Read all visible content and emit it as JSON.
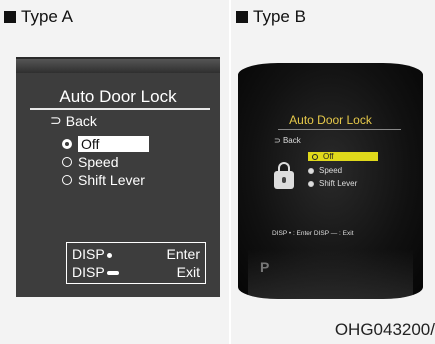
{
  "headers": {
    "type_a": "Type A",
    "type_b": "Type B"
  },
  "figure_code": "OHG043200/",
  "type_a": {
    "title": "Auto Door Lock",
    "back": "Back",
    "options": [
      "Off",
      "Speed",
      "Shift Lever"
    ],
    "selected": "Off",
    "help": {
      "disp": "DISP",
      "enter": "Enter",
      "exit": "Exit"
    }
  },
  "type_b": {
    "title": "Auto Door Lock",
    "back": "Back",
    "options": [
      "Off",
      "Speed",
      "Shift Lever"
    ],
    "selected": "Off",
    "help": "DISP • : Enter  DISP — : Exit",
    "gear": "P"
  },
  "colors": {
    "type_b_title": "#e6c94a",
    "type_b_highlight": "#e0d91b",
    "type_b_disp": "#e83a5a"
  }
}
